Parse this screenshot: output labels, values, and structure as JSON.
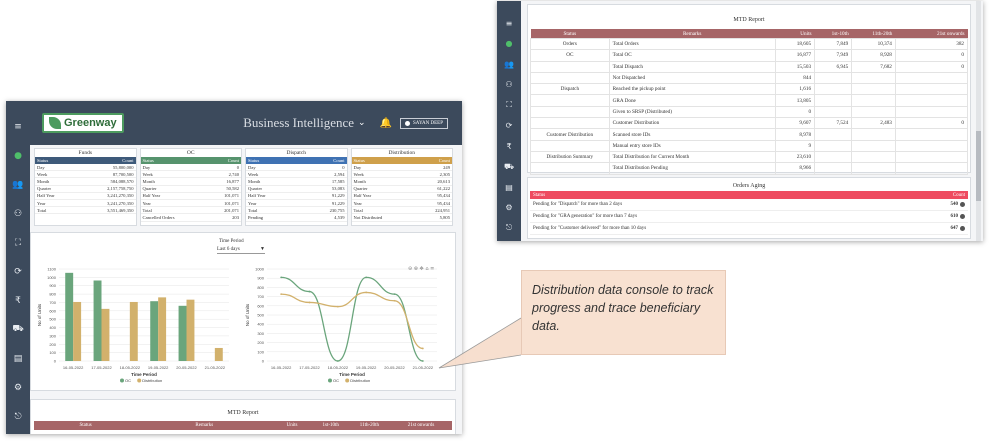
{
  "dashboard": {
    "logo_text": "Greenway",
    "app_title": "Business Intelligence",
    "user_label": "SAYAN DEEP",
    "summary": [
      {
        "title": "Funds",
        "color": "#3e5a7a",
        "header": [
          "Status",
          "Count"
        ],
        "rows": [
          [
            "Day",
            "55,800,000"
          ],
          [
            "Week",
            "87,700,500"
          ],
          [
            "Month",
            "584,088,570"
          ],
          [
            "Quarter",
            "2,157,758,750"
          ],
          [
            "Half Year",
            "3,241,270,350"
          ],
          [
            "Year",
            "3,241,270,350"
          ],
          [
            "Total",
            "3,551,469,350"
          ]
        ]
      },
      {
        "title": "OC",
        "color": "#56936d",
        "header": [
          "Status",
          "Count"
        ],
        "rows": [
          [
            "Day",
            "0"
          ],
          [
            "Week",
            "2,740"
          ],
          [
            "Month",
            "16,877"
          ],
          [
            "Quarter",
            "50,582"
          ],
          [
            "Half Year",
            "101,071"
          ],
          [
            "Year",
            "101,071"
          ],
          [
            "Total",
            "201,071"
          ],
          [
            "Cancelled Orders",
            "203"
          ]
        ]
      },
      {
        "title": "Dispatch",
        "color": "#3f72b3",
        "header": [
          "Status",
          "Count"
        ],
        "rows": [
          [
            "Day",
            "0"
          ],
          [
            "Week",
            "2,594"
          ],
          [
            "Month",
            "17,585"
          ],
          [
            "Quarter",
            "53,083"
          ],
          [
            "Half Year",
            "91,229"
          ],
          [
            "Year",
            "91,229"
          ],
          [
            "Total",
            "230,755"
          ],
          [
            "Pending",
            "4,539"
          ]
        ]
      },
      {
        "title": "Distribution",
        "color": "#cfa04b",
        "header": [
          "Status",
          "Count"
        ],
        "rows": [
          [
            "Day",
            "249"
          ],
          [
            "Week",
            "2,305"
          ],
          [
            "Month",
            "20,613"
          ],
          [
            "Quarter",
            "61,222"
          ],
          [
            "Half Year",
            "95,434"
          ],
          [
            "Year",
            "95,434"
          ],
          [
            "Total",
            "224,951"
          ],
          [
            "Not Distributed",
            "5,805"
          ]
        ]
      }
    ],
    "time_period_label": "Time Period",
    "time_period_value": "Last 6 days",
    "chart_toolbar": "⊖ ⊕ ✥ ⌂ ≡",
    "bottom_report_title": "MTD Report",
    "bottom_report_header": [
      "Status",
      "Remarks",
      "Units",
      "1st-10th",
      "11th-20th",
      "21st onwards"
    ]
  },
  "chart_data": [
    {
      "type": "bar",
      "categories": [
        "16-05-2022",
        "17-05-2022",
        "18-05-2022",
        "19-05-2022",
        "20-05-2022",
        "21-05-2022"
      ],
      "series": [
        {
          "name": "OC",
          "color": "#6aa57c",
          "values": [
            1150,
            1050,
            0,
            780,
            720,
            0
          ]
        },
        {
          "name": "Distribution",
          "color": "#d2b16c",
          "values": [
            770,
            680,
            770,
            830,
            800,
            170
          ]
        }
      ],
      "xlabel": "Time Period",
      "ylabel": "No of Units",
      "ylim": [
        0,
        1200
      ],
      "yticks": [
        "1100",
        "1000",
        "900",
        "800",
        "700",
        "600",
        "500",
        "400",
        "300",
        "200",
        "100",
        "0"
      ]
    },
    {
      "type": "line",
      "categories": [
        "16-05-2022",
        "17-05-2022",
        "18-05-2022",
        "19-05-2022",
        "20-05-2022",
        "21-05-2022"
      ],
      "series": [
        {
          "name": "OC",
          "color": "#6aa57c",
          "values": [
            1000,
            830,
            0,
            1000,
            800,
            0
          ]
        },
        {
          "name": "Distribution",
          "color": "#d2b16c",
          "values": [
            800,
            700,
            650,
            820,
            720,
            150
          ]
        }
      ],
      "xlabel": "Time Period",
      "ylabel": "No of Units",
      "ylim": [
        0,
        1100
      ],
      "yticks": [
        "1000",
        "900",
        "800",
        "700",
        "600",
        "500",
        "400",
        "300",
        "200",
        "100",
        "0"
      ]
    }
  ],
  "mtd": {
    "title": "MTD Report",
    "header": [
      "Status",
      "Remarks",
      "Units",
      "1st-10th",
      "11th-20th",
      "21st onwards"
    ],
    "rows": [
      [
        "Orders",
        "Total Orders",
        "18,605",
        "7,849",
        "10,374",
        "382"
      ],
      [
        "OC",
        "Total OC",
        "16,877",
        "7,949",
        "8,928",
        "0"
      ],
      [
        "",
        "Total Dispatch",
        "15,503",
        "6,945",
        "7,682",
        "0"
      ],
      [
        "",
        "Not Dispatched",
        "844",
        "",
        "",
        ""
      ],
      [
        "Dispatch",
        "Reached the pickup point",
        "1,616",
        "",
        "",
        ""
      ],
      [
        "",
        "GRA Done",
        "13,805",
        "",
        "",
        ""
      ],
      [
        "",
        "Given to SRSP (Distributed)",
        "0",
        "",
        "",
        ""
      ],
      [
        "",
        "Customer Distribution",
        "9,607",
        "7,524",
        "2,483",
        "0"
      ],
      [
        "Customer Distribution",
        "Scanned store IDs",
        "8,978",
        "",
        "",
        ""
      ],
      [
        "",
        "Manual entry store IDs",
        "9",
        "",
        "",
        ""
      ],
      [
        "Distribution Summary",
        "Total Distribution for Current Month",
        "23,610",
        "",
        "",
        ""
      ],
      [
        "",
        "Total Distribution Pending",
        "8,966",
        "",
        "",
        ""
      ]
    ]
  },
  "aging": {
    "title": "Orders Aging",
    "header": [
      "Status",
      "Count"
    ],
    "rows": [
      {
        "label": "Pending for \"Dispatch\" for more than 2 days",
        "value": "540"
      },
      {
        "label": "Pending for \"GRA generation\" for more than 7 days",
        "value": "610"
      },
      {
        "label": "Pending for \"Customer delivered\" for more than 10 days",
        "value": "647"
      }
    ]
  },
  "callout": {
    "text": "Distribution data console to track progress and trace beneficiary data."
  },
  "icons": [
    "menu-icon",
    "globe-icon",
    "users-icon",
    "user-group-icon",
    "hierarchy-icon",
    "sync-icon",
    "rupee-icon",
    "truck-icon",
    "document-icon",
    "settings-icon",
    "logout-icon"
  ]
}
